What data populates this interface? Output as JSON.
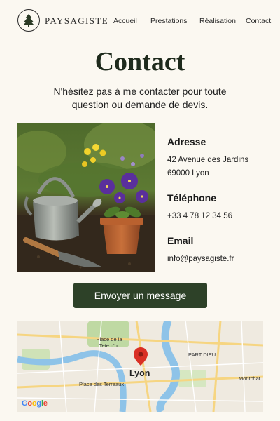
{
  "header": {
    "brand": "PAYSAGISTE",
    "nav": [
      "Accueil",
      "Prestations",
      "Réalisation",
      "Contact"
    ],
    "logo_icon": "pine-tree-icon"
  },
  "page": {
    "title": "Contact",
    "subtitle": "N'hésitez pas à me contacter pour toute question ou demande de devis."
  },
  "contact": {
    "address_label": "Adresse",
    "address_line1": "42 Avenue des Jardins",
    "address_line2": "69000 Lyon",
    "phone_label": "Téléphone",
    "phone": "+33 4 78 12 34 56",
    "email_label": "Email",
    "email": "info@paysagiste.fr"
  },
  "cta": {
    "label": "Envoyer un message"
  },
  "map": {
    "city": "Lyon",
    "labels": [
      "Place de la Tete d'or",
      "PART DIEU",
      "Place des Terreaux",
      "Montchat"
    ],
    "attribution": "Google",
    "pin_icon": "map-pin-icon"
  },
  "colors": {
    "accent": "#2d4128",
    "background": "#fbf8f1",
    "pin": "#d93025"
  }
}
